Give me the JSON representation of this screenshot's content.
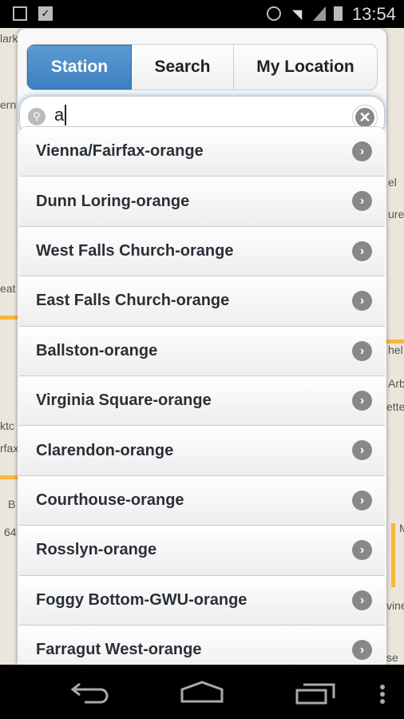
{
  "status_bar": {
    "time": "13:54",
    "icons": [
      "image-icon",
      "clipboard-check-icon",
      "alarm-icon",
      "wifi-icon",
      "signal-icon",
      "battery-icon"
    ]
  },
  "tabs": [
    {
      "label": "Station",
      "active": true
    },
    {
      "label": "Search",
      "active": false
    },
    {
      "label": "My Location",
      "active": false
    }
  ],
  "search": {
    "value": "a"
  },
  "stations": [
    "Vienna/Fairfax-orange",
    "Dunn Loring-orange",
    "West Falls Church-orange",
    "East Falls Church-orange",
    "Ballston-orange",
    "Virginia Square-orange",
    "Clarendon-orange",
    "Courthouse-orange",
    "Rosslyn-orange",
    "Foggy Bottom-GWU-orange",
    "Farragut West-orange"
  ],
  "map_labels": [
    "lark",
    "ern",
    "eat",
    "ktc",
    "rfax",
    "B",
    "64",
    "el",
    "ure",
    "hel",
    "Arb",
    "ette",
    "M",
    "vine",
    "se"
  ],
  "colors": {
    "accent": "#3d7fbf",
    "road": "#f6b73c"
  }
}
